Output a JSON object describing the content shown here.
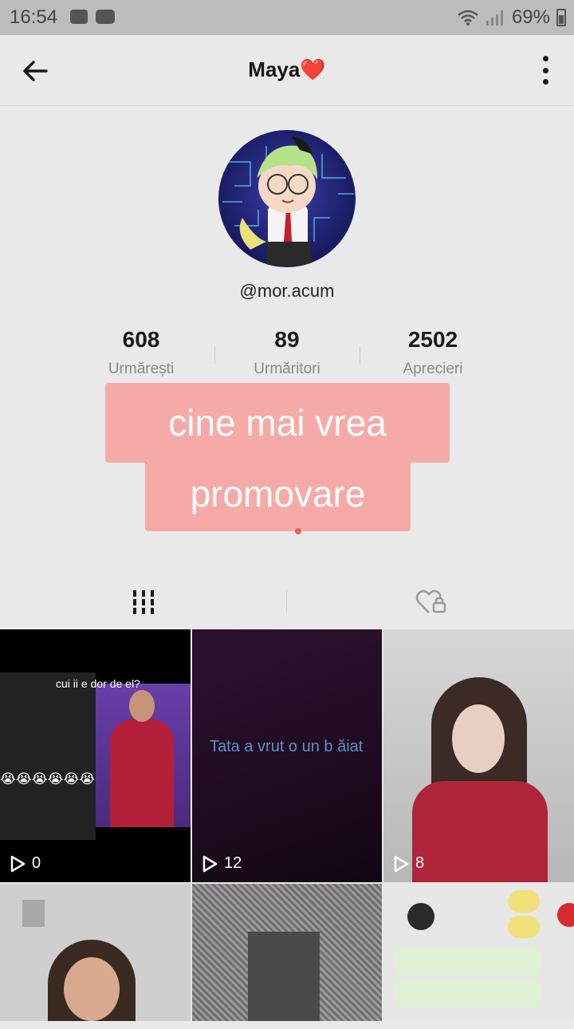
{
  "status_bar": {
    "time": "16:54",
    "battery": "69%",
    "icons_left": [
      "photo-icon",
      "youtube-icon",
      "app-grid-icon"
    ],
    "icons_right": [
      "wifi-icon",
      "signal-icon",
      "battery-icon"
    ]
  },
  "header": {
    "title": "Maya❤️",
    "back_icon": "arrow-left-icon",
    "more_icon": "more-vertical-icon"
  },
  "profile": {
    "username": "@mor.acum",
    "stats": [
      {
        "value": "608",
        "label": "Urmărești"
      },
      {
        "value": "89",
        "label": "Urmăritori"
      },
      {
        "value": "2502",
        "label": "Aprecieri"
      }
    ]
  },
  "overlay": {
    "line1": "cine mai vrea",
    "line2": "promovare",
    "color": "#f6aaa8"
  },
  "tabs": {
    "videos_icon": "grid-icon",
    "liked_icon": "heart-lock-icon"
  },
  "videos": [
    {
      "views": "0",
      "caption": "cui ii e dor de el?",
      "emoji": "😭😭😭😭😭😭"
    },
    {
      "views": "12",
      "caption": "Tata a vrut o un b ăiat"
    },
    {
      "views": "8"
    },
    {
      "views": ""
    },
    {
      "views": ""
    },
    {
      "views": ""
    }
  ]
}
